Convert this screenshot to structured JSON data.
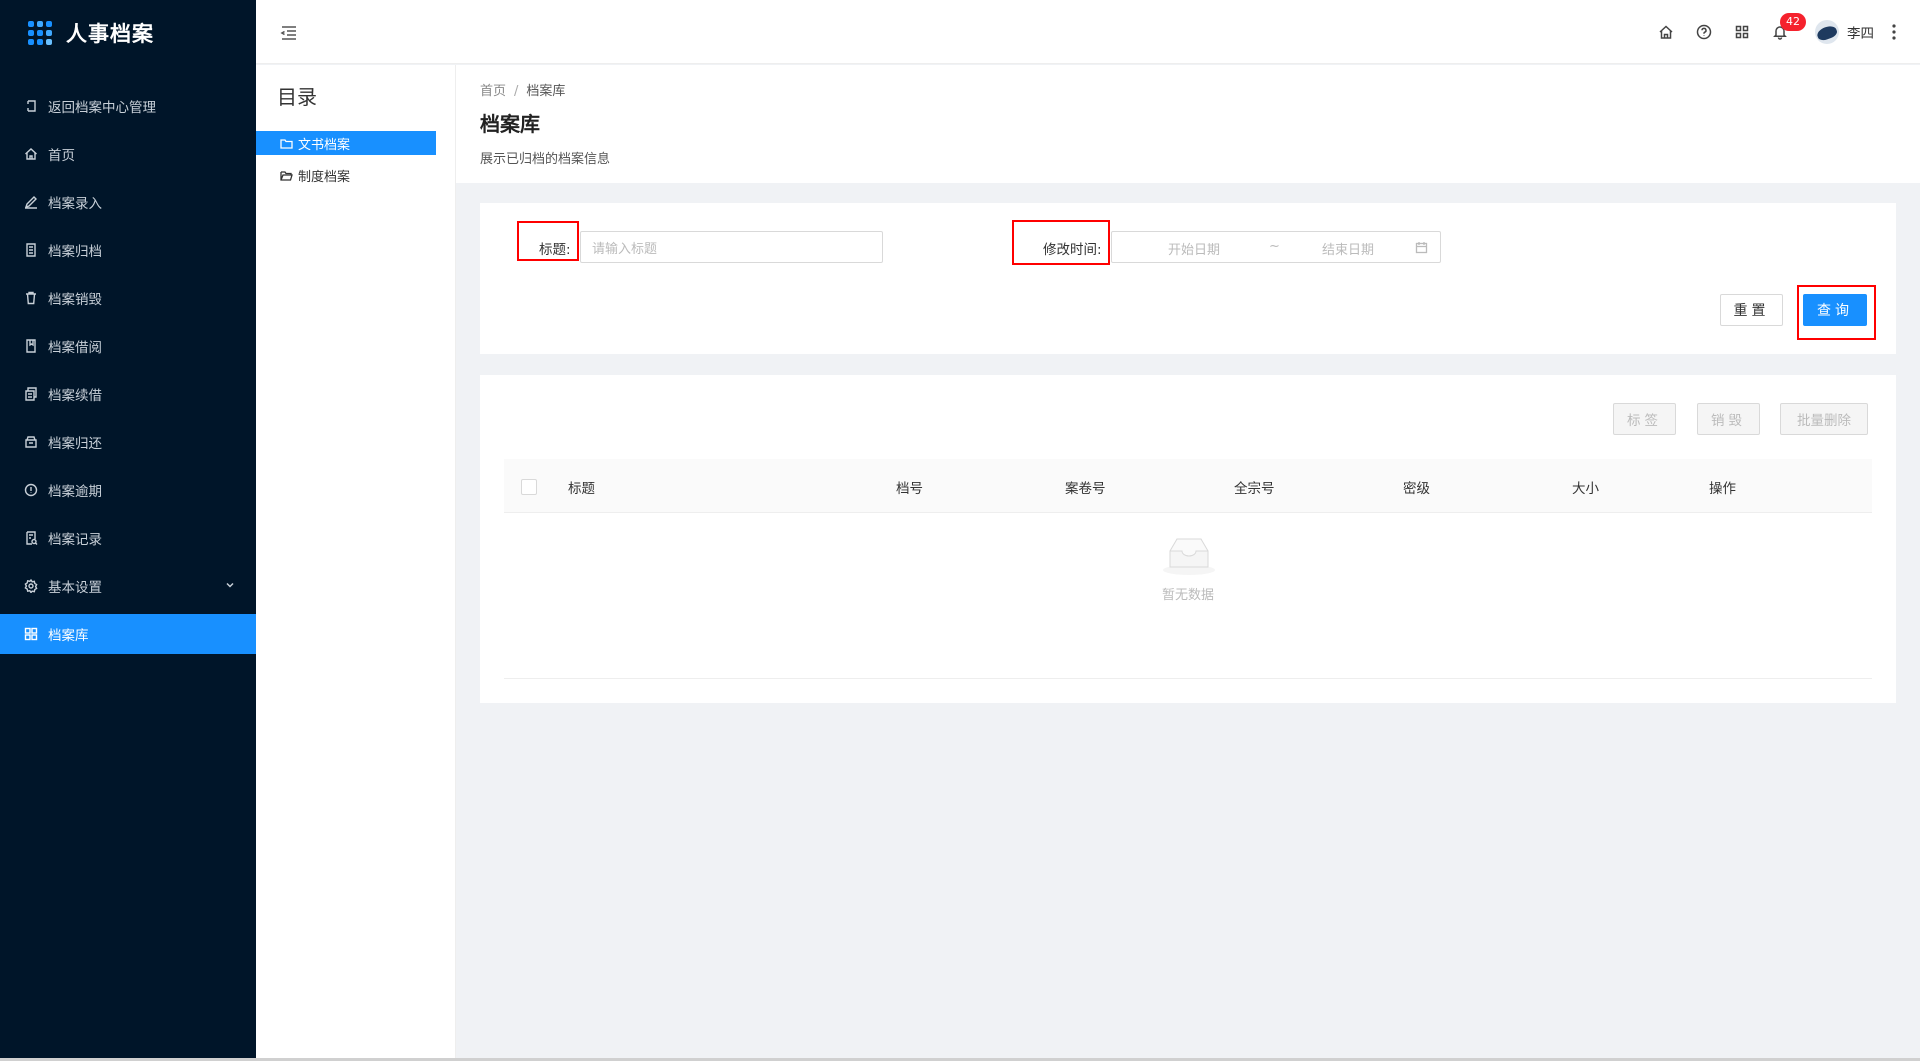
{
  "app": {
    "title": "人事档案"
  },
  "sidebar": {
    "items": [
      {
        "label": "返回档案中心管理",
        "icon": "return-icon"
      },
      {
        "label": "首页",
        "icon": "home-icon"
      },
      {
        "label": "档案录入",
        "icon": "edit-icon"
      },
      {
        "label": "档案归档",
        "icon": "file-icon"
      },
      {
        "label": "档案销毁",
        "icon": "trash-icon"
      },
      {
        "label": "档案借阅",
        "icon": "book-icon"
      },
      {
        "label": "档案续借",
        "icon": "copy-icon"
      },
      {
        "label": "档案归还",
        "icon": "box-icon"
      },
      {
        "label": "档案逾期",
        "icon": "alert-circle-icon"
      },
      {
        "label": "档案记录",
        "icon": "record-icon"
      },
      {
        "label": "基本设置",
        "icon": "gear-icon"
      },
      {
        "label": "档案库",
        "icon": "grid-icon",
        "active": true
      }
    ]
  },
  "header": {
    "notification_count": "42",
    "user_name": "李四"
  },
  "tree": {
    "title": "目录",
    "nodes": [
      {
        "label": "文书档案",
        "selected": true
      },
      {
        "label": "制度档案",
        "selected": false
      }
    ]
  },
  "page": {
    "breadcrumb": [
      "首页",
      "/",
      "档案库"
    ],
    "title": "档案库",
    "description": "展示已归档的档案信息"
  },
  "search": {
    "title_label": "标题:",
    "title_placeholder": "请输入标题",
    "time_label": "修改时间:",
    "start_placeholder": "开始日期",
    "range_sep": "~",
    "end_placeholder": "结束日期",
    "reset_label": "重置",
    "query_label": "查询"
  },
  "table": {
    "toolbar": [
      "标签",
      "销毁",
      "批量删除"
    ],
    "columns": [
      "标题",
      "档号",
      "案卷号",
      "全宗号",
      "密级",
      "大小",
      "操作"
    ],
    "rows": [],
    "empty_text": "暂无数据"
  },
  "colors": {
    "primary": "#1890ff",
    "sidebar_bg": "#001529",
    "highlight_box": "#ff0000",
    "badge": "#f5222d"
  }
}
